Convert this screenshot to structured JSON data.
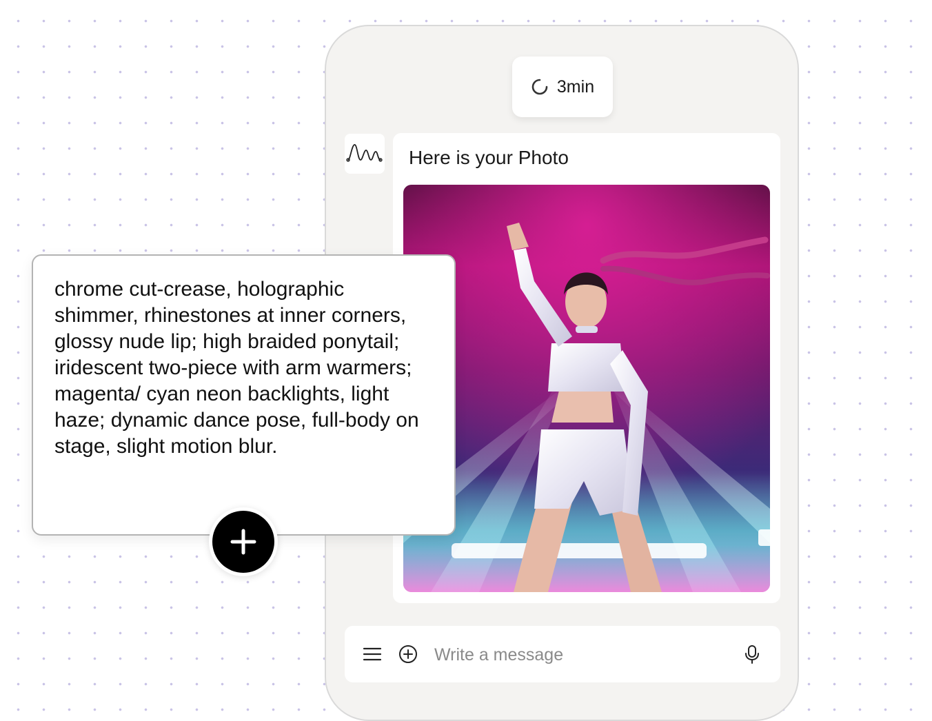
{
  "chat": {
    "timer": {
      "icon": "spinner-icon",
      "label": "3min"
    },
    "bot_avatar_icon": "waveform-logo-icon",
    "message": {
      "text": "Here is your Photo"
    },
    "photo_alt": "Generated photo of a dancer on a neon-lit stage"
  },
  "composer": {
    "placeholder": "Write a message",
    "menu_icon": "menu-icon",
    "add_icon": "plus-circle-icon",
    "mic_icon": "microphone-icon"
  },
  "prompt_card": {
    "text": "chrome cut-crease, holographic shimmer, rhinestones at inner corners, glossy nude lip; high braided ponytail; iridescent two-piece with arm warmers; magenta/ cyan neon backlights, light haze; dynamic dance pose, full-body on stage, slight motion blur.",
    "add_button_icon": "plus-icon"
  },
  "colors": {
    "phone_bg": "#f4f3f1",
    "card_border": "#b3b3b3",
    "dot_grid": "#c9c3e6",
    "accent_magenta": "#a0126e",
    "accent_cyan": "#5fe0e8"
  }
}
